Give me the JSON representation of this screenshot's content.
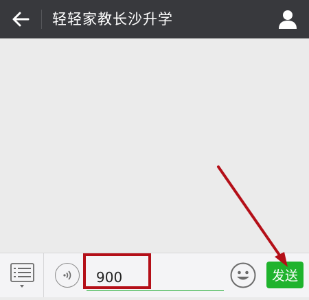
{
  "header": {
    "title": "轻轻家教长沙升学",
    "icons": {
      "back": "back-arrow-icon",
      "profile": "user-profile-icon"
    },
    "background": "#38393d"
  },
  "composer": {
    "input_value": "900",
    "send_label": "发送",
    "icons": {
      "menu": "menu-list-icon",
      "voice": "voice-icon",
      "emoji": "emoji-icon"
    },
    "send_color": "#1fb32d",
    "input_underline_color": "#39b54a"
  },
  "annotation": {
    "highlight_color": "#b40f18",
    "arrow_color": "#b40f18"
  }
}
